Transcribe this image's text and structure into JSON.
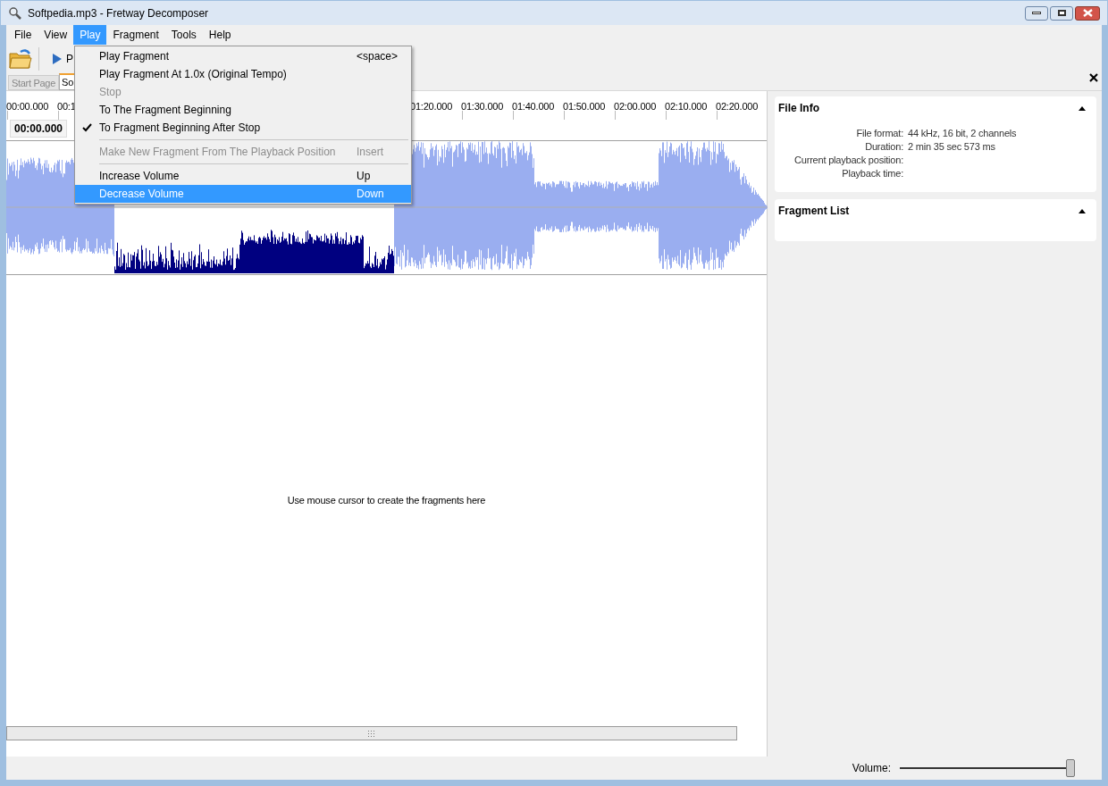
{
  "window": {
    "title": "Softpedia.mp3 - Fretway Decomposer"
  },
  "menu_bar": [
    {
      "label": "File",
      "selected": false
    },
    {
      "label": "View",
      "selected": false
    },
    {
      "label": "Play",
      "selected": true
    },
    {
      "label": "Fragment",
      "selected": false
    },
    {
      "label": "Tools",
      "selected": false
    },
    {
      "label": "Help",
      "selected": false
    }
  ],
  "toolbar": {
    "play_label": "P"
  },
  "tabs": [
    {
      "label": "Start Page",
      "selected": false
    },
    {
      "label": "So",
      "selected": true
    }
  ],
  "ruler": {
    "left_labels": [
      "00:00.000",
      "00:1"
    ],
    "right_labels": [
      "01:20.000",
      "01:30.000",
      "01:40.000",
      "01:50.000",
      "02:00.000",
      "02:10.000",
      "02:20.000"
    ],
    "position": "00:00.000"
  },
  "canvas_message": "Use mouse cursor to create the fragments here",
  "play_menu": [
    {
      "kind": "item",
      "label": "Play Fragment",
      "shortcut": "<space>",
      "disabled": false,
      "checked": false,
      "selected": false
    },
    {
      "kind": "item",
      "label": "Play Fragment At 1.0x (Original Tempo)",
      "disabled": false,
      "checked": false,
      "selected": false
    },
    {
      "kind": "item",
      "label": "Stop",
      "disabled": true,
      "checked": false,
      "selected": false
    },
    {
      "kind": "item",
      "label": "To The Fragment Beginning",
      "disabled": false,
      "checked": false,
      "selected": false
    },
    {
      "kind": "item",
      "label": "To Fragment Beginning After Stop",
      "disabled": false,
      "checked": true,
      "selected": false
    },
    {
      "kind": "separator"
    },
    {
      "kind": "item",
      "label": "Make New Fragment From The Playback Position",
      "shortcut": "Insert",
      "disabled": true,
      "checked": false,
      "selected": false
    },
    {
      "kind": "separator"
    },
    {
      "kind": "item",
      "label": "Increase Volume",
      "shortcut": "Up",
      "disabled": false,
      "checked": false,
      "selected": false
    },
    {
      "kind": "item",
      "label": "Decrease Volume",
      "shortcut": "Down",
      "disabled": false,
      "checked": false,
      "selected": true
    }
  ],
  "file_info": {
    "title": "File Info",
    "rows": [
      {
        "label": "File format:",
        "value": "44 kHz, 16 bit, 2 channels"
      },
      {
        "label": "Duration:",
        "value": "2 min 35 sec 573 ms"
      },
      {
        "label": "Current playback position:"
      },
      {
        "label": "Playback time:"
      }
    ]
  },
  "fragment_list": {
    "title": "Fragment List"
  },
  "status_bar": {
    "volume_label": "Volume:",
    "level": 1
  }
}
